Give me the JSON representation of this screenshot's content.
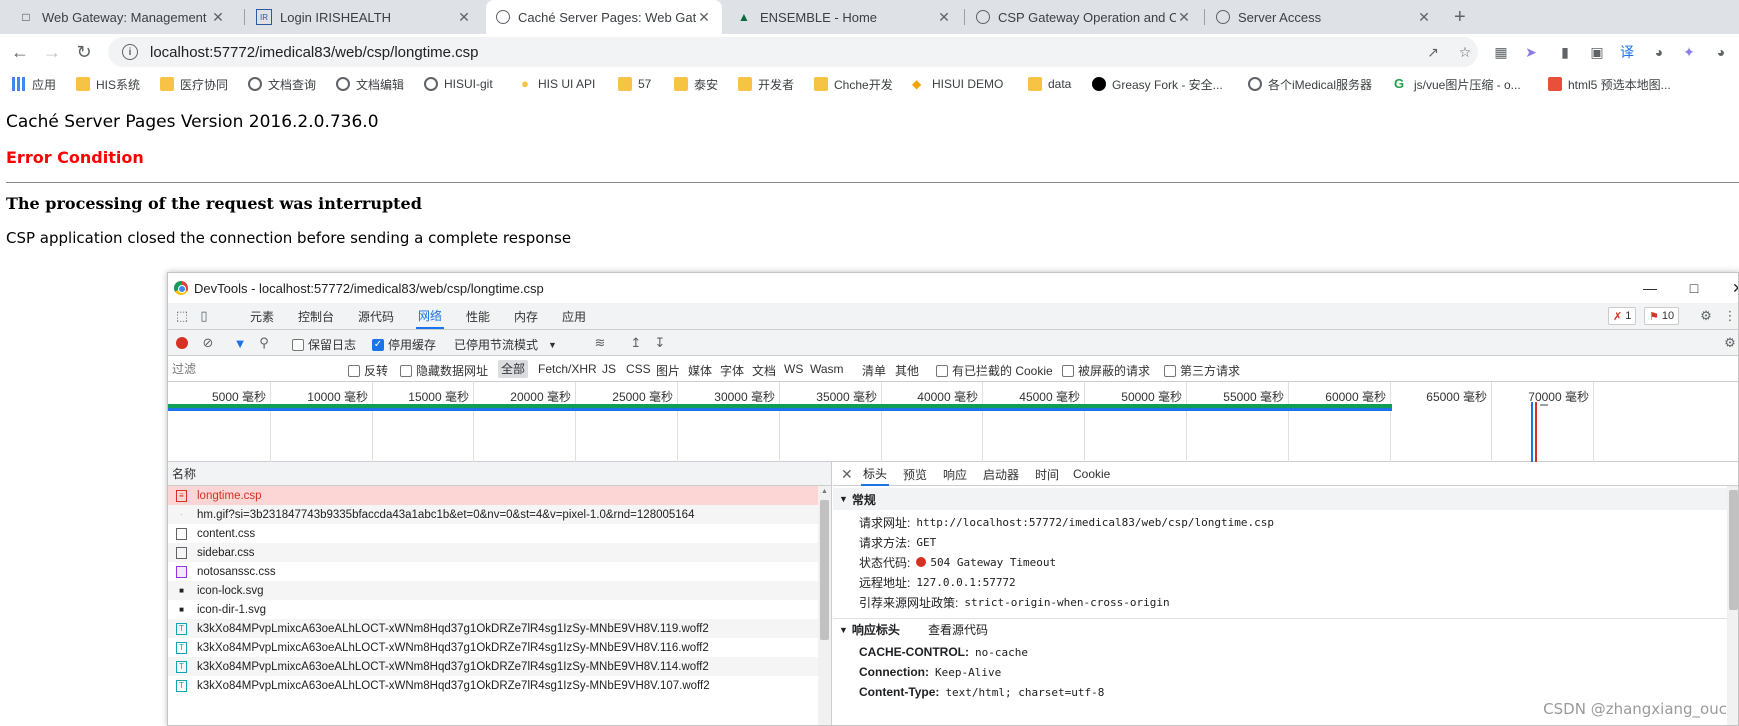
{
  "tabs": [
    {
      "title": "Web Gateway: Management",
      "icon": "page-icon"
    },
    {
      "title": "Login IRISHEALTH",
      "icon": "iris-icon"
    },
    {
      "title": "Caché Server Pages: Web Gate",
      "icon": "page-icon"
    },
    {
      "title": "ENSEMBLE - Home",
      "icon": "ensemble-icon"
    },
    {
      "title": "CSP Gateway Operation and C",
      "icon": "globe-icon"
    },
    {
      "title": "Server Access",
      "icon": "globe-icon"
    }
  ],
  "url": "localhost:57772/imedical83/web/csp/longtime.csp",
  "bookmarks": [
    "应用",
    "HIS系统",
    "医疗协同",
    "文档查询",
    "文档编辑",
    "HISUI-git",
    "HIS UI API",
    "57",
    "泰安",
    "开发者",
    "Chche开发",
    "HISUI DEMO",
    "data",
    "Greasy Fork - 安全...",
    "各个iMedical服务器",
    "js/vue图片压缩 - o...",
    "html5 预选本地图..."
  ],
  "page": {
    "version": "Caché Server Pages Version 2016.2.0.736.0",
    "error_condition": "Error Condition",
    "error_title": "The processing of the request was interrupted",
    "error_message": "CSP application closed the connection before sending a complete response"
  },
  "devtools": {
    "title": "DevTools - localhost:57772/imedical83/web/csp/longtime.csp",
    "panels": [
      "元素",
      "控制台",
      "源代码",
      "网络",
      "性能",
      "内存",
      "应用"
    ],
    "active_panel": "网络",
    "error_count": "1",
    "warning_count": "10",
    "netbar": {
      "preserve_log": "保留日志",
      "disable_cache": "停用缓存",
      "throttle": "已停用节流模式"
    },
    "filter": {
      "placeholder": "过滤",
      "invert": "反转",
      "hide_data_urls": "隐藏数据网址",
      "types": [
        "全部",
        "Fetch/XHR",
        "JS",
        "CSS",
        "图片",
        "媒体",
        "字体",
        "文档",
        "WS",
        "Wasm",
        "清单",
        "其他"
      ],
      "blocked_cookies": "有已拦截的 Cookie",
      "blocked_requests": "被屏蔽的请求",
      "third_party": "第三方请求"
    },
    "timeline_ticks": [
      "5000 毫秒",
      "10000 毫秒",
      "15000 毫秒",
      "20000 毫秒",
      "25000 毫秒",
      "30000 毫秒",
      "35000 毫秒",
      "40000 毫秒",
      "45000 毫秒",
      "50000 毫秒",
      "55000 毫秒",
      "60000 毫秒",
      "65000 毫秒",
      "70000 毫秒"
    ],
    "list_header": "名称",
    "requests": [
      {
        "name": "longtime.csp",
        "type": "doc",
        "error": true
      },
      {
        "name": "hm.gif?si=3b231847743b9335bfaccda43a1abc1b&et=0&nv=0&st=4&v=pixel-1.0&rnd=128005164",
        "type": "img"
      },
      {
        "name": "content.css",
        "type": "css"
      },
      {
        "name": "sidebar.css",
        "type": "css"
      },
      {
        "name": "notosanssc.css",
        "type": "css-purple"
      },
      {
        "name": "icon-lock.svg",
        "type": "svg"
      },
      {
        "name": "icon-dir-1.svg",
        "type": "svg"
      },
      {
        "name": "k3kXo84MPvpLmixcA63oeALhLOCT-xWNm8Hqd37g1OkDRZe7lR4sg1IzSy-MNbE9VH8V.119.woff2",
        "type": "font"
      },
      {
        "name": "k3kXo84MPvpLmixcA63oeALhLOCT-xWNm8Hqd37g1OkDRZe7lR4sg1IzSy-MNbE9VH8V.116.woff2",
        "type": "font"
      },
      {
        "name": "k3kXo84MPvpLmixcA63oeALhLOCT-xWNm8Hqd37g1OkDRZe7lR4sg1IzSy-MNbE9VH8V.114.woff2",
        "type": "font"
      },
      {
        "name": "k3kXo84MPvpLmixcA63oeALhLOCT-xWNm8Hqd37g1OkDRZe7lR4sg1IzSy-MNbE9VH8V.107.woff2",
        "type": "font"
      }
    ],
    "detail_tabs": [
      "标头",
      "预览",
      "响应",
      "启动器",
      "时间",
      "Cookie"
    ],
    "general": {
      "section": "常规",
      "request_url_label": "请求网址:",
      "request_url": "http://localhost:57772/imedical83/web/csp/longtime.csp",
      "method_label": "请求方法:",
      "method": "GET",
      "status_label": "状态代码:",
      "status": "504 Gateway Timeout",
      "remote_label": "远程地址:",
      "remote": "127.0.0.1:57772",
      "referrer_label": "引荐来源网址政策:",
      "referrer": "strict-origin-when-cross-origin"
    },
    "response_headers": {
      "section": "响应标头",
      "view_source": "查看源代码",
      "items": [
        {
          "k": "CACHE-CONTROL:",
          "v": "no-cache"
        },
        {
          "k": "Connection:",
          "v": "Keep-Alive"
        },
        {
          "k": "Content-Type:",
          "v": "text/html; charset=utf-8"
        }
      ]
    }
  },
  "watermark": "CSDN @zhangxiang_ouc",
  "colors": {
    "error_red": "#ff0000",
    "accent": "#1a73e8",
    "timeline_green": "#0f9d58"
  }
}
